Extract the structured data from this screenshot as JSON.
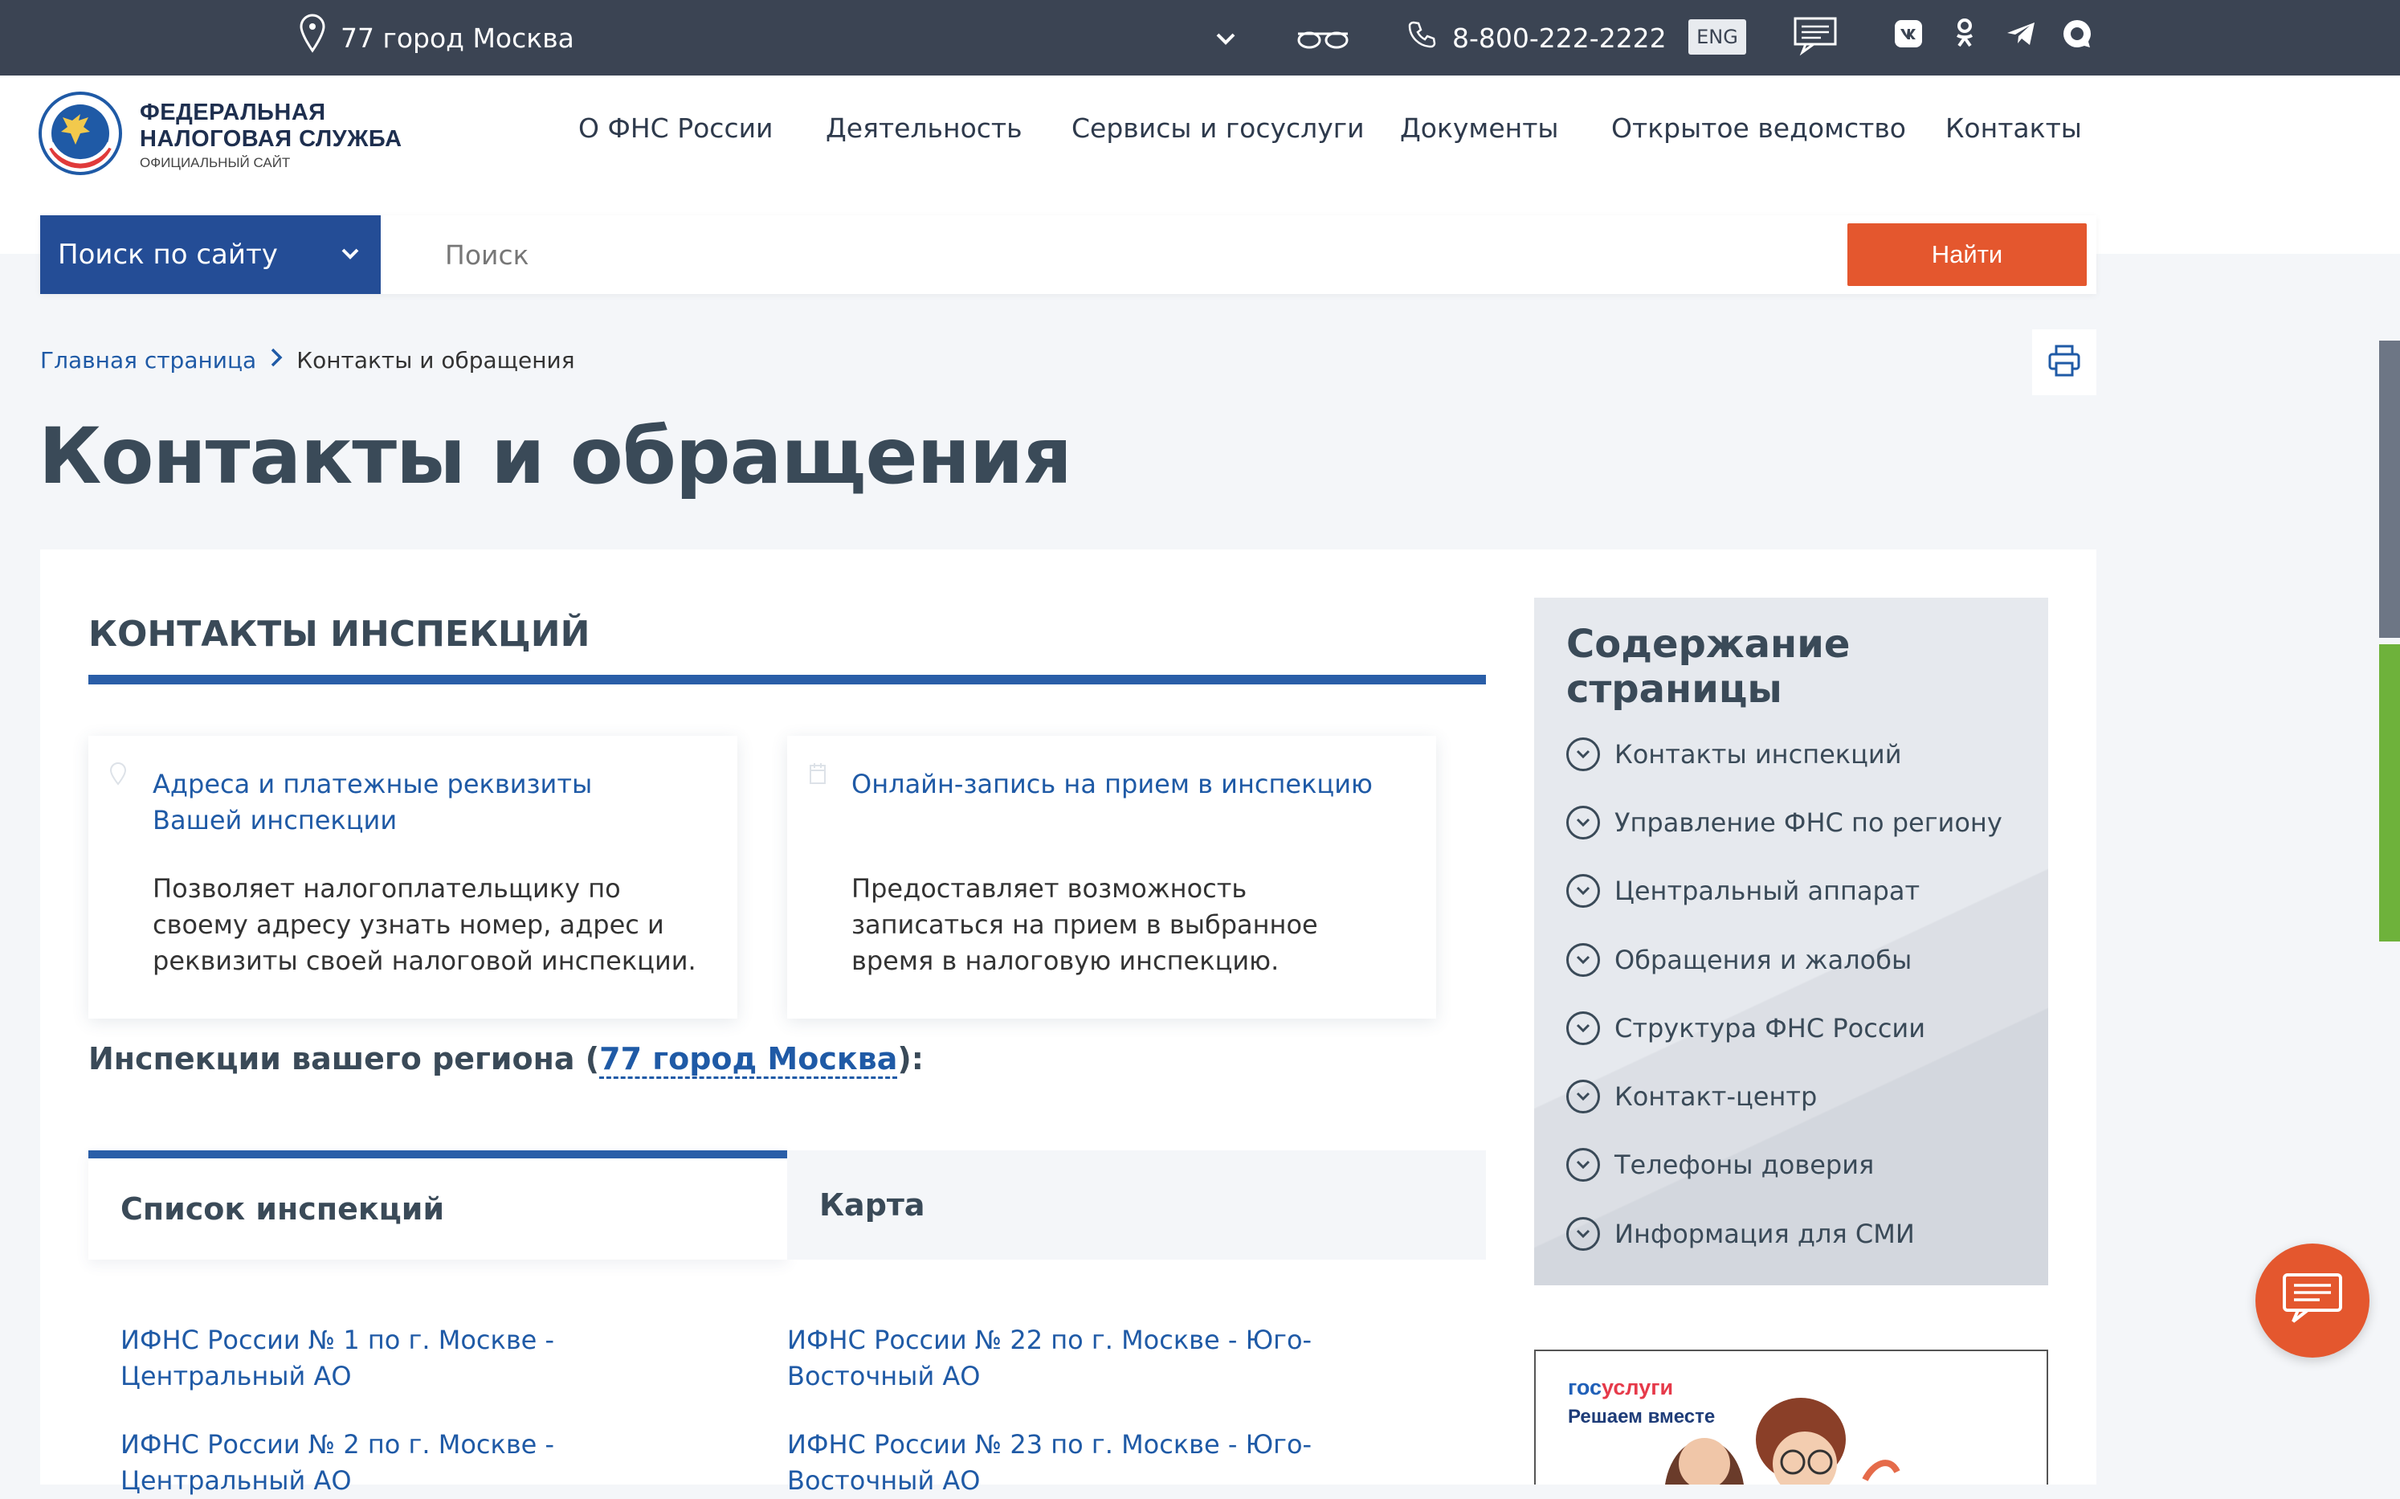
{
  "topbar": {
    "region": "77 город Москва",
    "phone": "8-800-222-2222",
    "lang": "ENG"
  },
  "logo": {
    "line1": "ФЕДЕРАЛЬНАЯ",
    "line2": "НАЛОГОВАЯ СЛУЖБА",
    "line3": "ОФИЦИАЛЬНЫЙ САЙТ"
  },
  "nav": [
    {
      "label": "О ФНС России"
    },
    {
      "label": "Деятельность"
    },
    {
      "label": "Сервисы и госуслуги"
    },
    {
      "label": "Документы"
    },
    {
      "label": "Открытое ведомство"
    },
    {
      "label": "Контакты"
    }
  ],
  "search": {
    "scope": "Поиск по сайту",
    "placeholder": "Поиск",
    "button": "Найти"
  },
  "breadcrumb": {
    "home": "Главная страница",
    "current": "Контакты и обращения"
  },
  "page_title": "Контакты и обращения",
  "section": {
    "title": "КОНТАКТЫ ИНСПЕКЦИЙ",
    "services": [
      {
        "link": "Адреса и платежные реквизиты Вашей инспекции",
        "desc": "Позволяет налогоплательщику по своему адресу узнать номер, адрес и реквизиты своей налоговой инспекции."
      },
      {
        "link": "Онлайн-запись на прием в инспекцию",
        "desc": "Предоставляет возможность записаться на прием в выбранное время в налоговую инспекцию."
      }
    ],
    "region_prefix": "Инспекции вашего региона (",
    "region_link": "77 город Москва",
    "region_suffix": "):",
    "tabs": [
      "Список инспекций",
      "Карта"
    ],
    "inspections": [
      "ИФНС России № 1 по г. Москве - Центральный АО",
      "ИФНС России № 22 по г. Москве - Юго-Восточный АО",
      "ИФНС России № 2 по г. Москве - Центральный АО",
      "ИФНС России № 23 по г. Москве - Юго-Восточный АО"
    ]
  },
  "toc": {
    "title": "Содержание страницы",
    "items": [
      "Контакты инспекций",
      "Управление ФНС по региону",
      "Центральный аппарат",
      "Обращения и жалобы",
      "Структура ФНС России",
      "Контакт-центр",
      "Телефоны доверия",
      "Информация для СМИ"
    ]
  },
  "banner": {
    "brand_part1": "гос",
    "brand_part2": "услуги",
    "slogan": "Решаем вместе"
  },
  "colors": {
    "topbar": "#3b4453",
    "brand_blue": "#244d96",
    "link": "#1f5aa6",
    "accent_orange": "#e4572e"
  }
}
